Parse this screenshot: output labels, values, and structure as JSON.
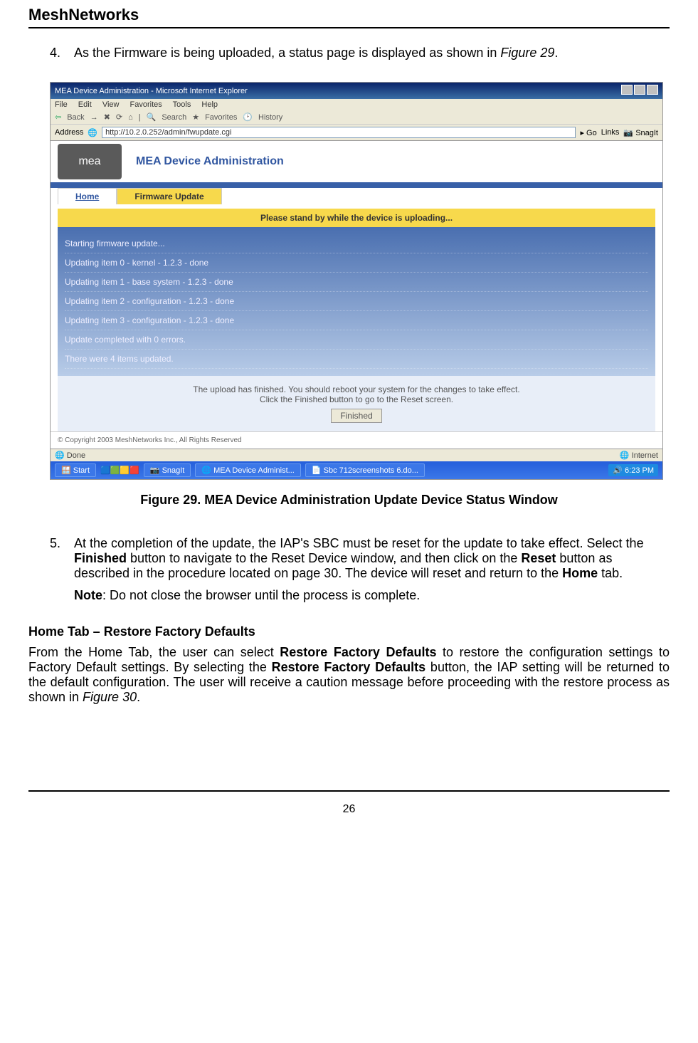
{
  "doc": {
    "header": "MeshNetworks",
    "page_number": "26"
  },
  "step4": {
    "num": "4.",
    "text_before_ref": "As the Firmware is being uploaded, a status page is displayed as shown in ",
    "figure_ref": "Figure 29",
    "text_after_ref": "."
  },
  "figure_caption": "Figure 29.      MEA Device Administration Update Device Status Window",
  "step5": {
    "num": "5.",
    "text": "At the completion of the update, the IAP's SBC must be reset for the update to take effect. Select the ",
    "bold1": "Finished",
    "text2": " button to navigate to the Reset Device window, and then click on the ",
    "bold2": "Reset",
    "text3": " button as described in the procedure located on page 30.  The device will reset and return to the ",
    "bold3": "Home",
    "text4": " tab.",
    "note_label": "Note",
    "note_text": ": Do not close the browser until the process is complete."
  },
  "section": {
    "heading": " Home Tab – Restore Factory Defaults",
    "para_a": "From the Home Tab, the user can select ",
    "bold1": "Restore Factory Defaults",
    "para_b": " to restore the configuration settings to Factory Default settings.  By selecting the ",
    "bold2": "Restore Factory Defaults",
    "para_c": " button, the IAP setting will be returned to the default configuration.  The user will receive a caution message before proceeding with the restore process as shown in ",
    "fig_ref": "Figure 30",
    "para_d": "."
  },
  "browser": {
    "title": "MEA Device Administration - Microsoft Internet Explorer",
    "menu": {
      "file": "File",
      "edit": "Edit",
      "view": "View",
      "favorites": "Favorites",
      "tools": "Tools",
      "help": "Help"
    },
    "toolbar": {
      "back": "Back",
      "search": "Search",
      "favorites": "Favorites",
      "history": "History"
    },
    "address_label": "Address",
    "url": "http://10.2.0.252/admin/fwupdate.cgi",
    "go": "Go",
    "links": "Links",
    "snagit": "SnagIt",
    "mea_logo": "mea",
    "mea_title": "MEA Device Administration",
    "tab_home": "Home",
    "tab_fw": "Firmware Update",
    "banner": "Please stand by while the device is uploading...",
    "status": [
      "Starting firmware update...",
      "Updating item 0 - kernel - 1.2.3 - done",
      "Updating item 1 - base system - 1.2.3 - done",
      "Updating item 2 - configuration - 1.2.3 - done",
      "Updating item 3 - configuration - 1.2.3 - done",
      "Update completed with 0 errors.",
      "There were 4 items updated."
    ],
    "finish_msg1": "The upload has finished. You should reboot your system for the changes to take effect.",
    "finish_msg2": "Click the Finished button to go to the Reset screen.",
    "finished_btn": "Finished",
    "copyright": "© Copyright 2003 MeshNetworks Inc., All Rights Reserved",
    "status_done": "Done",
    "status_internet": "Internet",
    "task_start": "Start",
    "task_snagit": "SnagIt",
    "task_mea": "MEA Device Administ...",
    "task_sbc": "Sbc 712screenshots 6.do...",
    "clock": "6:23 PM"
  }
}
